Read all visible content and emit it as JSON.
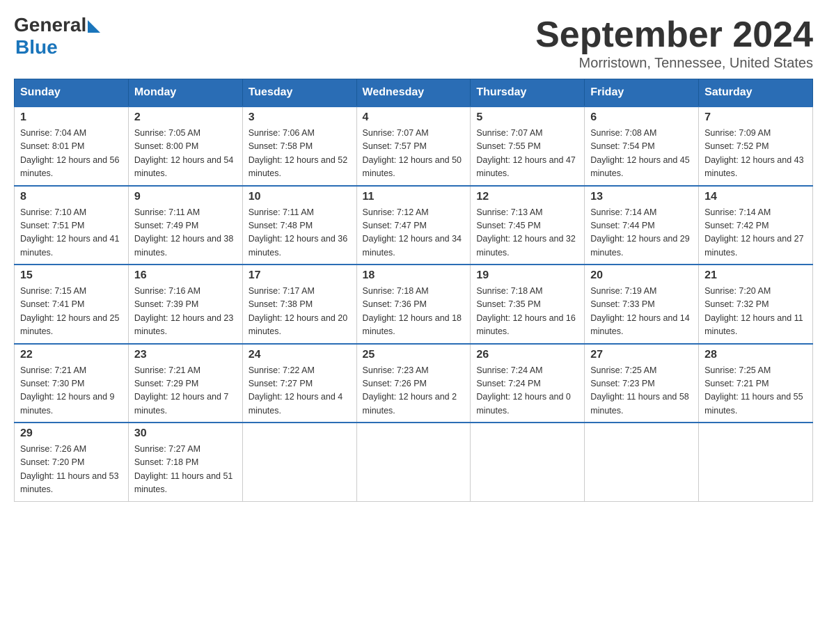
{
  "header": {
    "logo_general": "General",
    "logo_blue": "Blue",
    "title": "September 2024",
    "subtitle": "Morristown, Tennessee, United States"
  },
  "columns": [
    "Sunday",
    "Monday",
    "Tuesday",
    "Wednesday",
    "Thursday",
    "Friday",
    "Saturday"
  ],
  "weeks": [
    [
      {
        "day": "1",
        "sunrise": "Sunrise: 7:04 AM",
        "sunset": "Sunset: 8:01 PM",
        "daylight": "Daylight: 12 hours and 56 minutes."
      },
      {
        "day": "2",
        "sunrise": "Sunrise: 7:05 AM",
        "sunset": "Sunset: 8:00 PM",
        "daylight": "Daylight: 12 hours and 54 minutes."
      },
      {
        "day": "3",
        "sunrise": "Sunrise: 7:06 AM",
        "sunset": "Sunset: 7:58 PM",
        "daylight": "Daylight: 12 hours and 52 minutes."
      },
      {
        "day": "4",
        "sunrise": "Sunrise: 7:07 AM",
        "sunset": "Sunset: 7:57 PM",
        "daylight": "Daylight: 12 hours and 50 minutes."
      },
      {
        "day": "5",
        "sunrise": "Sunrise: 7:07 AM",
        "sunset": "Sunset: 7:55 PM",
        "daylight": "Daylight: 12 hours and 47 minutes."
      },
      {
        "day": "6",
        "sunrise": "Sunrise: 7:08 AM",
        "sunset": "Sunset: 7:54 PM",
        "daylight": "Daylight: 12 hours and 45 minutes."
      },
      {
        "day": "7",
        "sunrise": "Sunrise: 7:09 AM",
        "sunset": "Sunset: 7:52 PM",
        "daylight": "Daylight: 12 hours and 43 minutes."
      }
    ],
    [
      {
        "day": "8",
        "sunrise": "Sunrise: 7:10 AM",
        "sunset": "Sunset: 7:51 PM",
        "daylight": "Daylight: 12 hours and 41 minutes."
      },
      {
        "day": "9",
        "sunrise": "Sunrise: 7:11 AM",
        "sunset": "Sunset: 7:49 PM",
        "daylight": "Daylight: 12 hours and 38 minutes."
      },
      {
        "day": "10",
        "sunrise": "Sunrise: 7:11 AM",
        "sunset": "Sunset: 7:48 PM",
        "daylight": "Daylight: 12 hours and 36 minutes."
      },
      {
        "day": "11",
        "sunrise": "Sunrise: 7:12 AM",
        "sunset": "Sunset: 7:47 PM",
        "daylight": "Daylight: 12 hours and 34 minutes."
      },
      {
        "day": "12",
        "sunrise": "Sunrise: 7:13 AM",
        "sunset": "Sunset: 7:45 PM",
        "daylight": "Daylight: 12 hours and 32 minutes."
      },
      {
        "day": "13",
        "sunrise": "Sunrise: 7:14 AM",
        "sunset": "Sunset: 7:44 PM",
        "daylight": "Daylight: 12 hours and 29 minutes."
      },
      {
        "day": "14",
        "sunrise": "Sunrise: 7:14 AM",
        "sunset": "Sunset: 7:42 PM",
        "daylight": "Daylight: 12 hours and 27 minutes."
      }
    ],
    [
      {
        "day": "15",
        "sunrise": "Sunrise: 7:15 AM",
        "sunset": "Sunset: 7:41 PM",
        "daylight": "Daylight: 12 hours and 25 minutes."
      },
      {
        "day": "16",
        "sunrise": "Sunrise: 7:16 AM",
        "sunset": "Sunset: 7:39 PM",
        "daylight": "Daylight: 12 hours and 23 minutes."
      },
      {
        "day": "17",
        "sunrise": "Sunrise: 7:17 AM",
        "sunset": "Sunset: 7:38 PM",
        "daylight": "Daylight: 12 hours and 20 minutes."
      },
      {
        "day": "18",
        "sunrise": "Sunrise: 7:18 AM",
        "sunset": "Sunset: 7:36 PM",
        "daylight": "Daylight: 12 hours and 18 minutes."
      },
      {
        "day": "19",
        "sunrise": "Sunrise: 7:18 AM",
        "sunset": "Sunset: 7:35 PM",
        "daylight": "Daylight: 12 hours and 16 minutes."
      },
      {
        "day": "20",
        "sunrise": "Sunrise: 7:19 AM",
        "sunset": "Sunset: 7:33 PM",
        "daylight": "Daylight: 12 hours and 14 minutes."
      },
      {
        "day": "21",
        "sunrise": "Sunrise: 7:20 AM",
        "sunset": "Sunset: 7:32 PM",
        "daylight": "Daylight: 12 hours and 11 minutes."
      }
    ],
    [
      {
        "day": "22",
        "sunrise": "Sunrise: 7:21 AM",
        "sunset": "Sunset: 7:30 PM",
        "daylight": "Daylight: 12 hours and 9 minutes."
      },
      {
        "day": "23",
        "sunrise": "Sunrise: 7:21 AM",
        "sunset": "Sunset: 7:29 PM",
        "daylight": "Daylight: 12 hours and 7 minutes."
      },
      {
        "day": "24",
        "sunrise": "Sunrise: 7:22 AM",
        "sunset": "Sunset: 7:27 PM",
        "daylight": "Daylight: 12 hours and 4 minutes."
      },
      {
        "day": "25",
        "sunrise": "Sunrise: 7:23 AM",
        "sunset": "Sunset: 7:26 PM",
        "daylight": "Daylight: 12 hours and 2 minutes."
      },
      {
        "day": "26",
        "sunrise": "Sunrise: 7:24 AM",
        "sunset": "Sunset: 7:24 PM",
        "daylight": "Daylight: 12 hours and 0 minutes."
      },
      {
        "day": "27",
        "sunrise": "Sunrise: 7:25 AM",
        "sunset": "Sunset: 7:23 PM",
        "daylight": "Daylight: 11 hours and 58 minutes."
      },
      {
        "day": "28",
        "sunrise": "Sunrise: 7:25 AM",
        "sunset": "Sunset: 7:21 PM",
        "daylight": "Daylight: 11 hours and 55 minutes."
      }
    ],
    [
      {
        "day": "29",
        "sunrise": "Sunrise: 7:26 AM",
        "sunset": "Sunset: 7:20 PM",
        "daylight": "Daylight: 11 hours and 53 minutes."
      },
      {
        "day": "30",
        "sunrise": "Sunrise: 7:27 AM",
        "sunset": "Sunset: 7:18 PM",
        "daylight": "Daylight: 11 hours and 51 minutes."
      },
      null,
      null,
      null,
      null,
      null
    ]
  ]
}
